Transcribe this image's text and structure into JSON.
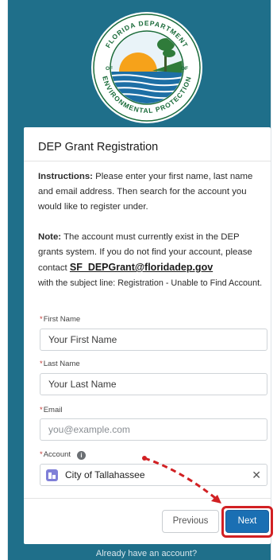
{
  "logo": {
    "top_text": "FLORIDA DEPARTMENT",
    "bottom_text": "ENVIRONMENTAL PROTECTION",
    "of_text": "OF"
  },
  "card": {
    "title": "DEP Grant Registration",
    "instructions_label": "Instructions:",
    "instructions_text": " Please enter your first name, last name and email address. Then search for the account you would like to register under.",
    "note_label": "Note:",
    "note_text_1": " The account must currently exist in the DEP grants system. If you do not find your account, please contact ",
    "note_email": "SF_DEPGrant@floridadep.gov",
    "note_text_2": "with the subject line: Registration - Unable to Find Account."
  },
  "form": {
    "required_mark": "*",
    "first_name_label": "First Name",
    "first_name_value": "Your First Name",
    "last_name_label": "Last Name",
    "last_name_value": "Your Last Name",
    "email_label": "Email",
    "email_placeholder": "you@example.com",
    "account_label": "Account",
    "account_value": "City of Tallahassee",
    "info_glyph": "i",
    "clear_glyph": "✕"
  },
  "buttons": {
    "previous": "Previous",
    "next": "Next"
  },
  "below_card_text": "Already have an account?",
  "colors": {
    "background": "#1f6f8a",
    "primary_button": "#1a6fb3",
    "annotation_red": "#d12023",
    "required_red": "#c23934"
  }
}
